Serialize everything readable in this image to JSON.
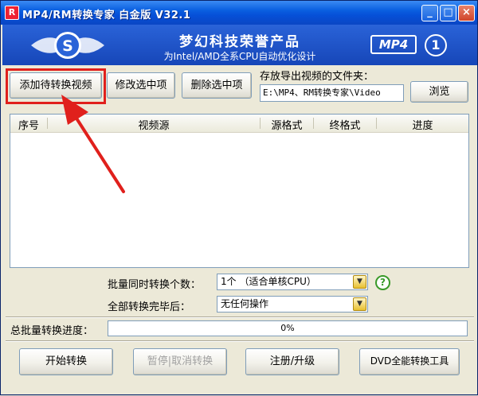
{
  "window": {
    "title": "MP4/RM转换专家 白金版 V32.1",
    "app_icon": "R",
    "minimize_glyph": "_",
    "maximize_glyph": "□",
    "close_glyph": "×"
  },
  "banner": {
    "title": "梦幻科技荣誉产品",
    "subtitle": "为Intel/AMD全系CPU自动优化设计",
    "logo_letter": "S",
    "badge": "MP4",
    "round_badge": "1"
  },
  "toolbar": {
    "add_video": "添加待转换视频",
    "edit_selected": "修改选中项",
    "delete_selected": "删除选中项"
  },
  "export_folder": {
    "label": "存放导出视频的文件夹：",
    "path": "E:\\MP4、RM转换专家\\Video",
    "browse": "浏览"
  },
  "table": {
    "columns": [
      "序号",
      "视频源",
      "源格式",
      "终格式",
      "进度"
    ],
    "rows": []
  },
  "batch": {
    "concurrent_label": "批量同时转换个数：",
    "concurrent_value": "1个 （适合单核CPU）",
    "after_label": "全部转换完毕后：",
    "after_value": "无任何操作",
    "help_glyph": "?"
  },
  "progress": {
    "label": "总批量转换进度：",
    "value": 0,
    "text": "0%"
  },
  "actions": {
    "start": "开始转换",
    "pause_cancel": "暂停|取消转换",
    "register": "注册/升级",
    "dvd_tool": "DVD全能转换工具"
  },
  "colors": {
    "annotation_red": "#e0201c",
    "banner_blue": "#1646b8",
    "title_blue": "#0650d8"
  },
  "icons": {
    "logo": "s-logo-icon",
    "help": "help-icon",
    "dropdown": "chevron-down-icon",
    "annotation": "red-arrow-annotation"
  }
}
